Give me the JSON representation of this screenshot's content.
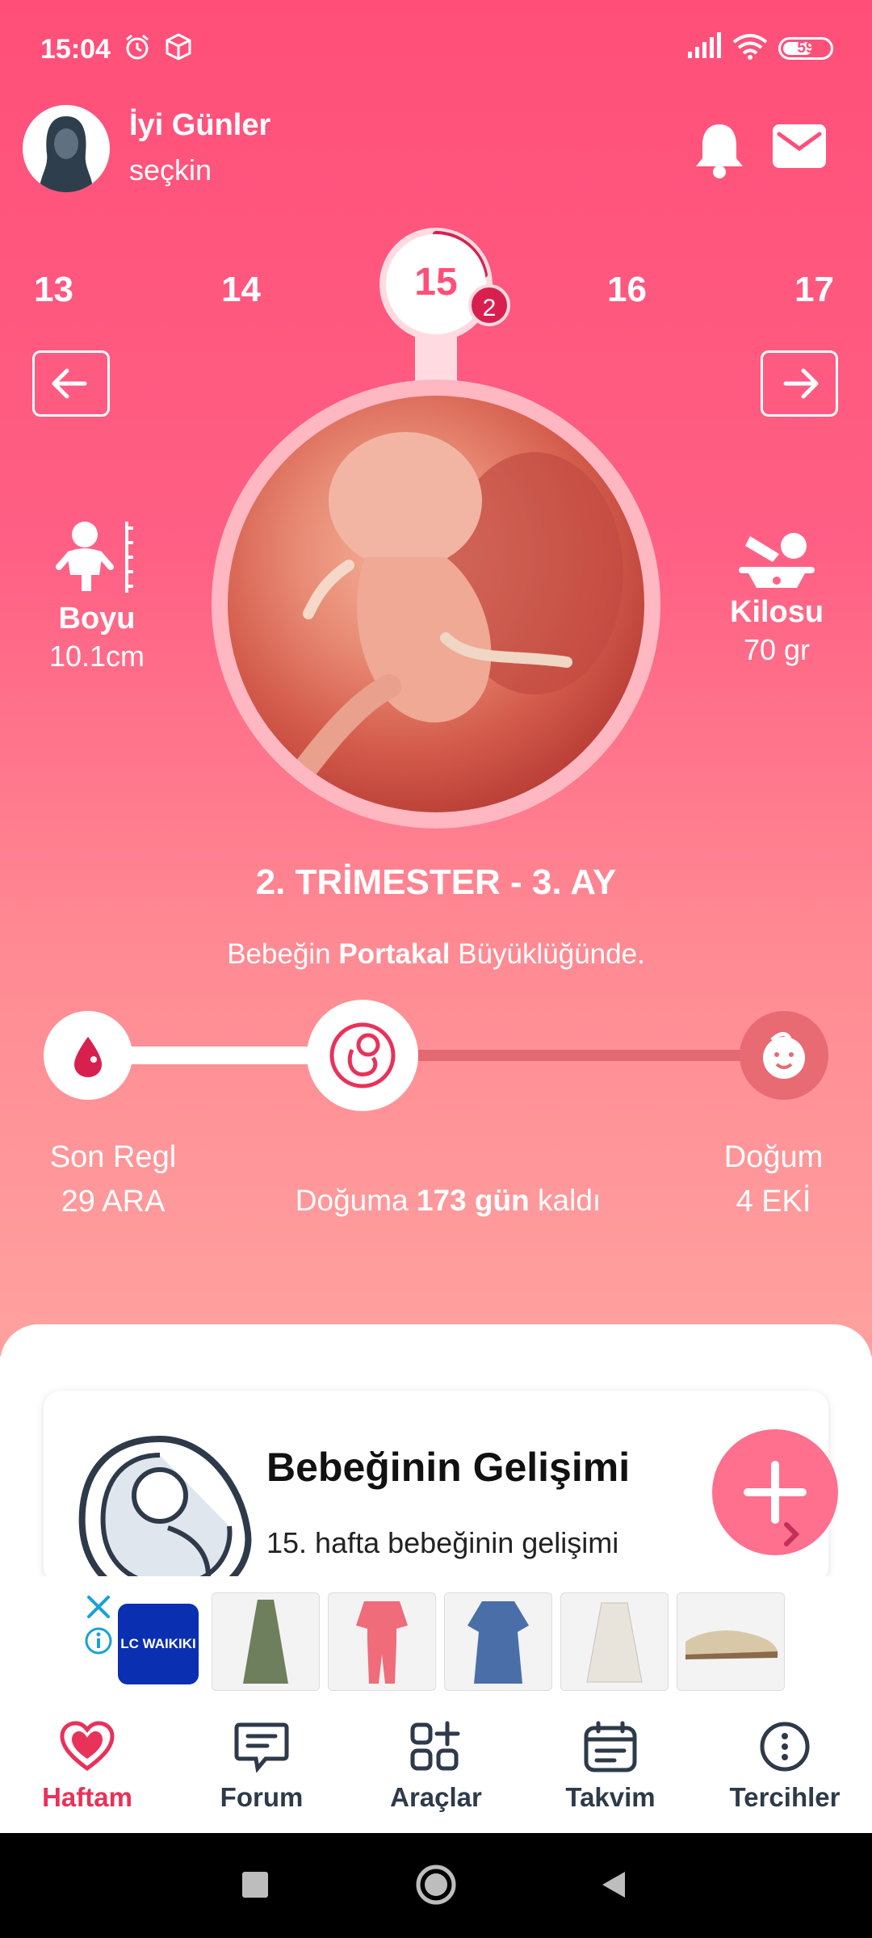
{
  "status_bar": {
    "time": "15:04",
    "battery": "59"
  },
  "header": {
    "greeting": "İyi Günler",
    "username": "seçkin"
  },
  "weeks": {
    "prev2": "13",
    "prev1": "14",
    "current": "15",
    "current_badge": "2",
    "next1": "16",
    "next2": "17"
  },
  "stats": {
    "length_label": "Boyu",
    "length_value": "10.1cm",
    "weight_label": "Kilosu",
    "weight_value": "70 gr"
  },
  "trimester": "2. TRİMESTER - 3. AY",
  "size_line": {
    "prefix": "Bebeğin ",
    "fruit": "Portakal",
    "suffix": " Büyüklüğünde."
  },
  "timeline": {
    "start_label": "Son Regl",
    "start_date": "29 ARA",
    "end_label": "Doğum",
    "end_date": "4 EKİ",
    "remaining_prefix": "Doğuma ",
    "remaining_value": "173 gün",
    "remaining_suffix": " kaldı"
  },
  "card": {
    "title": "Bebeğinin Gelişimi",
    "subtitle": "15. hafta bebeğinin gelişimi"
  },
  "ad": {
    "brand": "LC WAIKIKI"
  },
  "nav": [
    {
      "label": "Haftam",
      "icon": "heart-icon"
    },
    {
      "label": "Forum",
      "icon": "chat-icon"
    },
    {
      "label": "Araçlar",
      "icon": "tools-icon"
    },
    {
      "label": "Takvim",
      "icon": "calendar-icon"
    },
    {
      "label": "Tercihler",
      "icon": "more-icon"
    }
  ],
  "colors": {
    "primary": "#ff4f79",
    "accent": "#e8325a",
    "fab": "#ff6f8e"
  }
}
